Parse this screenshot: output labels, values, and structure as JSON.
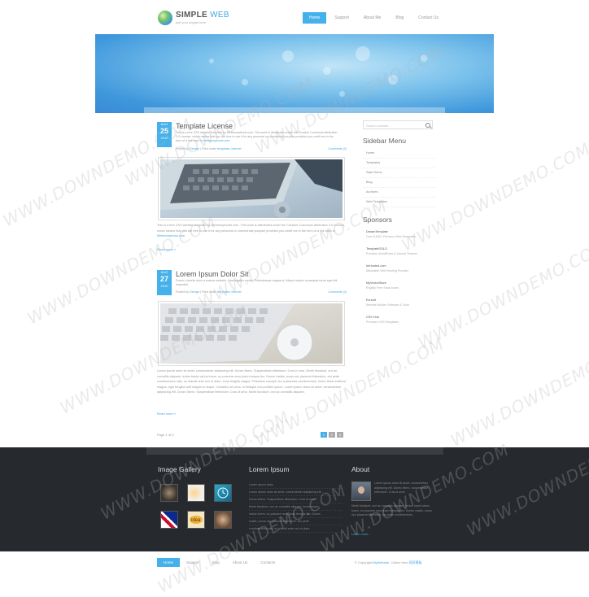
{
  "header": {
    "logo_title_a": "SIMPLE",
    "logo_title_b": "WEB",
    "logo_subtitle": "just your slogan here",
    "nav": [
      {
        "label": "Home",
        "active": true
      },
      {
        "label": "Support"
      },
      {
        "label": "About Me"
      },
      {
        "label": "Blog"
      },
      {
        "label": "Contact Us"
      }
    ]
  },
  "posts": [
    {
      "month": "AUG",
      "day": "25",
      "year": "2010",
      "title": "Template License",
      "meta_posted": "Posted by",
      "meta_author": "George",
      "meta_filed": "| Filed under",
      "meta_tags": "templates, internet",
      "comments": "Comments (3)",
      "excerpt": "This is a free CSS website template by Metamorphozis.com. This work is distributed under the Creative Commons Attribution 3.0 License, which means that you are free to use it for any personal or commercial purpose provided you credit me in the form of a link back to ",
      "excerpt_link": "Metamorphozis.com",
      "body": "This is a free CSS website template by Metamorphozis.com. This work is distributed under the Creative Commons Attribution 3.0 License, which means that you are free to use it for any personal or commercial purpose provided you credit me in the form of a link back to ",
      "body_link": "Metamorphozis.com",
      "readmore": "Read more »"
    },
    {
      "month": "AUG",
      "day": "27",
      "year": "2010",
      "title": "Lorem Ipsum Dolor Sit",
      "meta_posted": "Posted by",
      "meta_author": "George",
      "meta_filed": "| Filed under",
      "meta_tags": "templates, internet",
      "comments": "Comments (3)",
      "excerpt": "Donec Lobortis dolor a massa molestie. Nam sagittis metus, Pellentesque magna ut. Aliquet sapien consequat tortor eget elit imperdiet.",
      "body": "Lorem ipsum dolor sit amet, consectetuer adipiscing elit. Donec libero. Suspendisse bibendum. Cras id urna. Morbi tincidunt, orci ac convallis aliquam, lectus turpis varius lorem, eu posuere nunc justo tempus leo. Donec mattis, purus nec placerat bibendum, dui pede condimentum odio, ac blandit ante orci ut diam. Cras fringilla magna. Phasellus suscipit, leo a pharetra condimentum, lorem tellus eleifend magna, eget fringilla velit magna id neque. Curabitur vel urna. In tristique orci porttitor ipsum. Lorem ipsum dolor sit amet, consectetuer adipiscing elit. Donec libero. Suspendisse bibendum. Cras id urna. Morbi tincidunt, orci ac convallis aliquam.",
      "readmore": "Read more »"
    }
  ],
  "sidebar": {
    "search_placeholder": "Search website...",
    "menu_title": "Sidebar Menu",
    "menu": [
      "Home",
      "Templates",
      "Style Demo",
      "Blog",
      "Archives",
      "Web Templates"
    ],
    "sponsors_title": "Sponsors",
    "sponsors": [
      {
        "name": "DreamTemplate",
        "text": "Over 6,000+ Premium Web Templates"
      },
      {
        "name": "TemplateSOLD",
        "text": "Premium WordPress & Joomla Themes"
      },
      {
        "name": "ImHosted.com",
        "text": "Affordable Web Hosting Provider"
      },
      {
        "name": "MyVectorStore",
        "text": "Royalty Free Stock Icons"
      },
      {
        "name": "Evrsoft",
        "text": "Website Builder Software & Tools"
      },
      {
        "name": "CSS Hub",
        "text": "Premium CSS Templates"
      }
    ]
  },
  "pagination": {
    "info": "Page 1 of 3",
    "pages": [
      {
        "label": "1",
        "active": true
      },
      {
        "label": "2"
      },
      {
        "label": "3"
      }
    ]
  },
  "footer": {
    "gallery_title": "Image Gallery",
    "lorem_title": "Lorem Ipsum",
    "lorem_items": [
      "Lorem ipsum dolor",
      "Lorem ipsum dolor sit amet, consectetuer adipiscing elit.",
      "Donec libero. Suspendisse bibendum. Cras id urna.",
      "Morbi tincidunt, orci ac convallis aliquam, lectus turpis",
      "varius lorem, eu posuere nunc justo tempus leo. Donec",
      "mattis, purus nec placerat bibendum, dui pede",
      "condimentum odio, ac blandit ante orci ut diam."
    ],
    "about_title": "About",
    "about_text": "Lorem ipsum dolor sit amet, consectetuer adipiscing elit. Donec libero. Suspendisse bibendum. Cras id urna.",
    "about_text2": "Morbi tincidunt, orci ac convallis aliquam, lectus turpis varius lorem, eu posuere nunc justo tempus leo. Donec mattis, purus nec placerat bibendum, dui pede condimentum.",
    "learn_more": "Learn more..."
  },
  "bottom": {
    "nav": [
      {
        "label": "Home",
        "active": true
      },
      {
        "label": "Support"
      },
      {
        "label": "Blog"
      },
      {
        "label": "About Us"
      },
      {
        "label": "Contacts"
      }
    ],
    "copyright": "© Copyright ",
    "copyright_site": "MyWebsite",
    "copyright_by": ". Collect from ",
    "copyright_link": "网页模板"
  },
  "watermark": "WWW.DOWNDEMO.COM",
  "colors": {
    "accent": "#45b1ea",
    "footer_bg": "#26292d"
  }
}
